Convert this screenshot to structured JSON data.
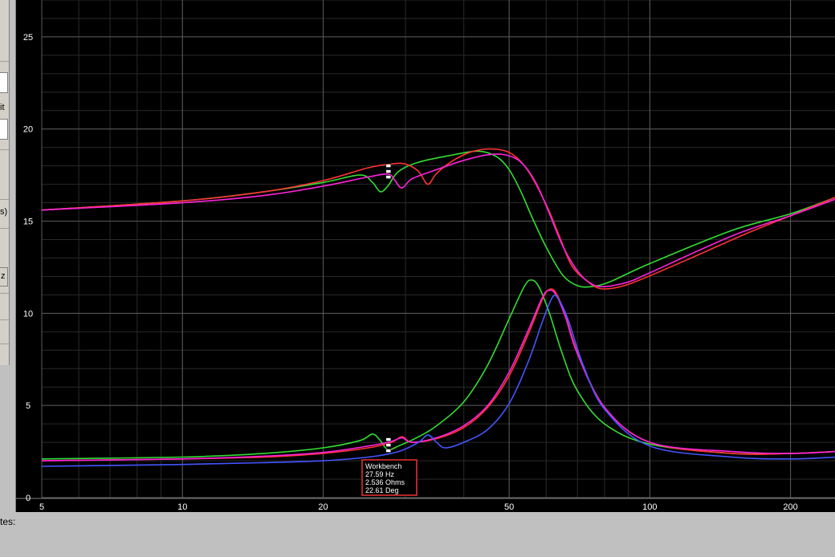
{
  "left_panel": {
    "label_it": "it",
    "label_s": "s)",
    "label_z": "z"
  },
  "bottom": {
    "notes_label": "tes:"
  },
  "chart_data": {
    "type": "line",
    "x_scale": "log",
    "xlim": [
      5,
      250
    ],
    "ylim": [
      0,
      27
    ],
    "x_ticks": [
      5,
      10,
      20,
      50,
      100,
      200
    ],
    "y_ticks": [
      0,
      5,
      10,
      15,
      20,
      25
    ],
    "grid": true,
    "colors": {
      "green": "#33dd33",
      "red": "#ff3333",
      "magenta": "#ff22dd",
      "blue": "#4455ff"
    },
    "series": [
      {
        "color": "green",
        "kind": "impedance",
        "points": [
          [
            5,
            15.6
          ],
          [
            10,
            16.1
          ],
          [
            15,
            16.6
          ],
          [
            20,
            17.1
          ],
          [
            24,
            17.5
          ],
          [
            25.5,
            17.1
          ],
          [
            26.5,
            16.6
          ],
          [
            27.5,
            16.9
          ],
          [
            29,
            17.7
          ],
          [
            32,
            18.2
          ],
          [
            38,
            18.6
          ],
          [
            43,
            18.8
          ],
          [
            47,
            18.5
          ],
          [
            50,
            17.8
          ],
          [
            53,
            16.6
          ],
          [
            56,
            15.2
          ],
          [
            60,
            13.6
          ],
          [
            65,
            12.1
          ],
          [
            70,
            11.5
          ],
          [
            75,
            11.45
          ],
          [
            82,
            11.7
          ],
          [
            100,
            12.7
          ],
          [
            150,
            14.5
          ],
          [
            200,
            15.4
          ],
          [
            250,
            16.3
          ]
        ]
      },
      {
        "color": "red",
        "kind": "impedance",
        "points": [
          [
            5,
            15.6
          ],
          [
            10,
            16.1
          ],
          [
            15,
            16.6
          ],
          [
            20,
            17.2
          ],
          [
            25,
            17.9
          ],
          [
            28,
            18.1
          ],
          [
            30,
            18.1
          ],
          [
            32,
            17.7
          ],
          [
            33.5,
            17.0
          ],
          [
            35,
            17.6
          ],
          [
            38,
            18.3
          ],
          [
            42,
            18.8
          ],
          [
            47,
            18.9
          ],
          [
            51,
            18.6
          ],
          [
            55,
            17.7
          ],
          [
            60,
            15.9
          ],
          [
            64,
            14.2
          ],
          [
            68,
            12.6
          ],
          [
            73,
            11.8
          ],
          [
            78,
            11.35
          ],
          [
            85,
            11.4
          ],
          [
            95,
            11.8
          ],
          [
            120,
            12.9
          ],
          [
            160,
            14.3
          ],
          [
            200,
            15.3
          ],
          [
            250,
            16.3
          ]
        ]
      },
      {
        "color": "magenta",
        "kind": "impedance",
        "points": [
          [
            5,
            15.6
          ],
          [
            10,
            16.0
          ],
          [
            15,
            16.4
          ],
          [
            20,
            16.9
          ],
          [
            25,
            17.4
          ],
          [
            27.6,
            17.55
          ],
          [
            28.5,
            17.2
          ],
          [
            29.5,
            16.8
          ],
          [
            31,
            17.3
          ],
          [
            35,
            17.8
          ],
          [
            40,
            18.3
          ],
          [
            45,
            18.6
          ],
          [
            49,
            18.6
          ],
          [
            53,
            18.2
          ],
          [
            57,
            17.1
          ],
          [
            61,
            15.4
          ],
          [
            65,
            13.7
          ],
          [
            70,
            12.3
          ],
          [
            75,
            11.6
          ],
          [
            80,
            11.45
          ],
          [
            90,
            11.7
          ],
          [
            100,
            12.2
          ],
          [
            150,
            14.2
          ],
          [
            200,
            15.3
          ],
          [
            250,
            16.2
          ]
        ]
      },
      {
        "color": "green",
        "kind": "phase",
        "points": [
          [
            5,
            2.1
          ],
          [
            10,
            2.2
          ],
          [
            15,
            2.4
          ],
          [
            20,
            2.7
          ],
          [
            24,
            3.1
          ],
          [
            25.5,
            3.45
          ],
          [
            26.5,
            3.1
          ],
          [
            27.5,
            2.6
          ],
          [
            29,
            2.8
          ],
          [
            32,
            3.3
          ],
          [
            35,
            3.9
          ],
          [
            40,
            5.2
          ],
          [
            45,
            7.2
          ],
          [
            50,
            9.7
          ],
          [
            54,
            11.5
          ],
          [
            56,
            11.8
          ],
          [
            58,
            11.4
          ],
          [
            61,
            10.0
          ],
          [
            65,
            7.8
          ],
          [
            70,
            5.8
          ],
          [
            80,
            4.0
          ],
          [
            100,
            2.9
          ],
          [
            150,
            2.4
          ],
          [
            200,
            2.4
          ],
          [
            250,
            2.5
          ]
        ]
      },
      {
        "color": "red",
        "kind": "phase",
        "points": [
          [
            5,
            2.0
          ],
          [
            10,
            2.1
          ],
          [
            15,
            2.2
          ],
          [
            20,
            2.4
          ],
          [
            25,
            2.7
          ],
          [
            28,
            3.0
          ],
          [
            29.5,
            3.3
          ],
          [
            31,
            3.0
          ],
          [
            35,
            3.2
          ],
          [
            40,
            3.8
          ],
          [
            45,
            4.9
          ],
          [
            50,
            6.6
          ],
          [
            55,
            8.9
          ],
          [
            59,
            10.8
          ],
          [
            61,
            11.3
          ],
          [
            63,
            11.1
          ],
          [
            66,
            9.9
          ],
          [
            70,
            7.9
          ],
          [
            80,
            4.9
          ],
          [
            100,
            3.0
          ],
          [
            150,
            2.4
          ],
          [
            200,
            2.4
          ],
          [
            250,
            2.5
          ]
        ]
      },
      {
        "color": "magenta",
        "kind": "phase",
        "points": [
          [
            5,
            2.0
          ],
          [
            10,
            2.1
          ],
          [
            15,
            2.25
          ],
          [
            20,
            2.45
          ],
          [
            25,
            2.8
          ],
          [
            28,
            3.05
          ],
          [
            29.5,
            3.25
          ],
          [
            31,
            3.0
          ],
          [
            35,
            3.25
          ],
          [
            40,
            3.9
          ],
          [
            45,
            5.0
          ],
          [
            50,
            6.8
          ],
          [
            55,
            9.1
          ],
          [
            59,
            10.9
          ],
          [
            61,
            11.25
          ],
          [
            63,
            11.0
          ],
          [
            66,
            9.8
          ],
          [
            70,
            7.8
          ],
          [
            80,
            4.9
          ],
          [
            100,
            3.0
          ],
          [
            150,
            2.5
          ],
          [
            200,
            2.4
          ],
          [
            250,
            2.5
          ]
        ]
      },
      {
        "color": "blue",
        "kind": "phase",
        "points": [
          [
            5,
            1.7
          ],
          [
            10,
            1.8
          ],
          [
            15,
            1.9
          ],
          [
            20,
            2.0
          ],
          [
            25,
            2.2
          ],
          [
            29,
            2.5
          ],
          [
            32,
            3.0
          ],
          [
            33.5,
            3.4
          ],
          [
            35,
            3.0
          ],
          [
            36.5,
            2.7
          ],
          [
            40,
            3.0
          ],
          [
            45,
            3.7
          ],
          [
            50,
            5.1
          ],
          [
            55,
            7.4
          ],
          [
            59,
            9.6
          ],
          [
            62,
            10.9
          ],
          [
            64,
            10.7
          ],
          [
            67,
            9.6
          ],
          [
            72,
            7.2
          ],
          [
            80,
            4.8
          ],
          [
            100,
            2.8
          ],
          [
            150,
            2.2
          ],
          [
            200,
            2.1
          ],
          [
            250,
            2.2
          ]
        ]
      }
    ],
    "cursor": {
      "x": 27.59,
      "y_top": 18.0,
      "y_bottom": 2.55
    },
    "annotation": {
      "lines": [
        "Workbench",
        "27.59 Hz",
        "2.536 Ohms",
        "22.61 Deg"
      ],
      "border_color": "#ee3333"
    }
  }
}
